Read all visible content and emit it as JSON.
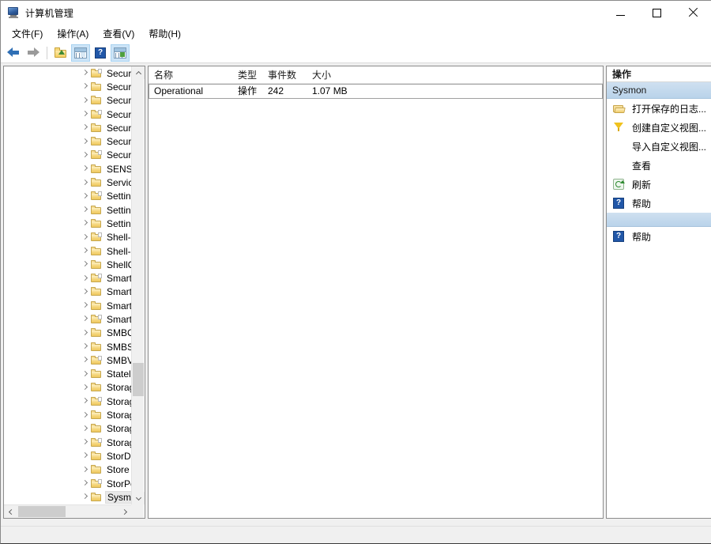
{
  "window": {
    "title": "计算机管理",
    "icon": "computer-management-icon",
    "caption": {
      "minimize": "─",
      "maximize": "□",
      "close": "✕"
    }
  },
  "menubar": {
    "items": [
      {
        "label": "文件(F)",
        "name": "menu-file"
      },
      {
        "label": "操作(A)",
        "name": "menu-action"
      },
      {
        "label": "查看(V)",
        "name": "menu-view"
      },
      {
        "label": "帮助(H)",
        "name": "menu-help"
      }
    ]
  },
  "toolbar": {
    "items": [
      {
        "name": "back-button",
        "icon": "back-arrow-icon",
        "enabled": true
      },
      {
        "name": "forward-button",
        "icon": "forward-arrow-icon",
        "enabled": false
      },
      {
        "name": "up-one-level-button",
        "icon": "folder-up-icon",
        "enabled": true
      },
      {
        "name": "show-hide-console-tree-button",
        "icon": "console-tree-icon",
        "checked": true
      },
      {
        "name": "help-button",
        "icon": "help-icon",
        "label": "?"
      },
      {
        "name": "show-hide-action-pane-button",
        "icon": "action-pane-icon",
        "checked": true
      }
    ]
  },
  "tree": {
    "items": [
      {
        "label": "Secur",
        "selected": false
      },
      {
        "label": "Secur",
        "selected": false
      },
      {
        "label": "Secur",
        "selected": false
      },
      {
        "label": "Secur",
        "selected": false
      },
      {
        "label": "Secur",
        "selected": false
      },
      {
        "label": "Secur",
        "selected": false
      },
      {
        "label": "Secur",
        "selected": false
      },
      {
        "label": "SENS",
        "selected": false
      },
      {
        "label": "Servic",
        "selected": false
      },
      {
        "label": "Settin",
        "selected": false
      },
      {
        "label": "Settin",
        "selected": false
      },
      {
        "label": "Settin",
        "selected": false
      },
      {
        "label": "Shell-",
        "selected": false
      },
      {
        "label": "Shell-",
        "selected": false
      },
      {
        "label": "ShellC",
        "selected": false
      },
      {
        "label": "Smart",
        "selected": false
      },
      {
        "label": "Smart",
        "selected": false
      },
      {
        "label": "Smart",
        "selected": false
      },
      {
        "label": "Smart",
        "selected": false
      },
      {
        "label": "SMBC",
        "selected": false
      },
      {
        "label": "SMBS",
        "selected": false
      },
      {
        "label": "SMBV",
        "selected": false
      },
      {
        "label": "Statel",
        "selected": false
      },
      {
        "label": "Storag",
        "selected": false
      },
      {
        "label": "Storag",
        "selected": false
      },
      {
        "label": "Storag",
        "selected": false
      },
      {
        "label": "Storag",
        "selected": false
      },
      {
        "label": "Storag",
        "selected": false
      },
      {
        "label": "StorD",
        "selected": false
      },
      {
        "label": "Store",
        "selected": false
      },
      {
        "label": "StorPe",
        "selected": false
      },
      {
        "label": "Sysmo",
        "selected": true
      }
    ]
  },
  "list": {
    "columns": [
      {
        "label": "名称",
        "name": "column-name"
      },
      {
        "label": "类型",
        "name": "column-type"
      },
      {
        "label": "事件数",
        "name": "column-event-count"
      },
      {
        "label": "大小",
        "name": "column-size"
      }
    ],
    "rows": [
      {
        "name": "Operational",
        "type": "操作",
        "events": "242",
        "size": "1.07 MB",
        "focused": true
      }
    ]
  },
  "actions": {
    "title": "操作",
    "sections": [
      {
        "header": "Sysmon",
        "items": [
          {
            "label": "打开保存的日志...",
            "icon": "open-folder-icon",
            "name": "action-open-saved-log"
          },
          {
            "label": "创建自定义视图...",
            "icon": "funnel-icon",
            "name": "action-create-custom-view"
          },
          {
            "label": "导入自定义视图...",
            "icon": "none",
            "name": "action-import-custom-view"
          },
          {
            "label": "查看",
            "icon": "none",
            "name": "action-view"
          },
          {
            "label": "刷新",
            "icon": "refresh-icon",
            "name": "action-refresh"
          },
          {
            "label": "帮助",
            "icon": "help-icon",
            "name": "action-help"
          }
        ]
      },
      {
        "header": "",
        "items": [
          {
            "label": "帮助",
            "icon": "help-icon",
            "name": "action-help-secondary"
          }
        ]
      }
    ]
  },
  "statusbar": {
    "text": ""
  },
  "colors": {
    "accent": "#2157a8",
    "section_header_bg": "#b9d3ea",
    "toolbar_checked_bg": "#cce4f7",
    "folder_yellow": "#f4d479",
    "selection_gray": "#e8e8e8"
  }
}
